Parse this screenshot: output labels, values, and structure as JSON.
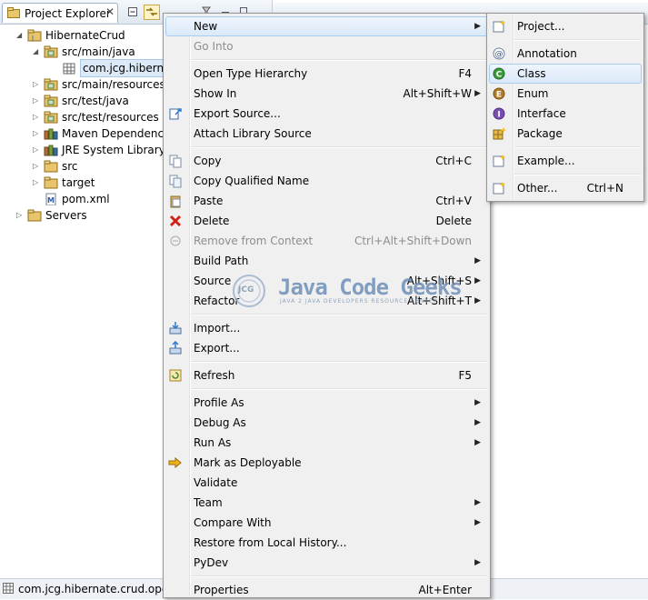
{
  "explorer": {
    "tab_title": "Project Explorer",
    "close_glyph": "✕",
    "tree": [
      {
        "label": "HibernateCrud",
        "level": 0,
        "expanded": true,
        "icon": "project-icon"
      },
      {
        "label": "src/main/java",
        "level": 1,
        "expanded": true,
        "icon": "source-folder-icon"
      },
      {
        "label": "com.jcg.hibernat",
        "level": 2,
        "selected": true,
        "icon": "package-icon"
      },
      {
        "label": "src/main/resources",
        "level": 1,
        "expanded": false,
        "icon": "source-folder-icon"
      },
      {
        "label": "src/test/java",
        "level": 1,
        "expanded": false,
        "icon": "source-folder-icon"
      },
      {
        "label": "src/test/resources",
        "level": 1,
        "expanded": false,
        "icon": "source-folder-icon"
      },
      {
        "label": "Maven Dependencie",
        "level": 1,
        "expanded": false,
        "icon": "library-icon"
      },
      {
        "label": "JRE System Library [j",
        "level": 1,
        "expanded": false,
        "icon": "library-icon"
      },
      {
        "label": "src",
        "level": 1,
        "expanded": false,
        "icon": "folder-icon"
      },
      {
        "label": "target",
        "level": 1,
        "expanded": false,
        "icon": "folder-icon"
      },
      {
        "label": "pom.xml",
        "level": 1,
        "icon": "maven-file-icon"
      },
      {
        "label": "Servers",
        "level": 0,
        "expanded": false,
        "icon": "folder-icon"
      }
    ]
  },
  "status_bar": {
    "text": "com.jcg.hibernate.crud.operat"
  },
  "context_menu": {
    "items": [
      {
        "type": "item",
        "label": "New",
        "submenu": true,
        "highlighted": true
      },
      {
        "type": "item",
        "label": "Go Into",
        "disabled": true
      },
      {
        "type": "sep"
      },
      {
        "type": "item",
        "label": "Open Type Hierarchy",
        "shortcut": "F4"
      },
      {
        "type": "item",
        "label": "Show In",
        "shortcut": "Alt+Shift+W",
        "submenu": true
      },
      {
        "type": "item",
        "label": "Export Source...",
        "icon": "export-source-icon"
      },
      {
        "type": "item",
        "label": "Attach Library Source"
      },
      {
        "type": "sep"
      },
      {
        "type": "item",
        "label": "Copy",
        "shortcut": "Ctrl+C",
        "icon": "copy-icon"
      },
      {
        "type": "item",
        "label": "Copy Qualified Name",
        "icon": "copy-qualified-icon"
      },
      {
        "type": "item",
        "label": "Paste",
        "shortcut": "Ctrl+V",
        "icon": "paste-icon"
      },
      {
        "type": "item",
        "label": "Delete",
        "shortcut": "Delete",
        "icon": "delete-icon"
      },
      {
        "type": "item",
        "label": "Remove from Context",
        "shortcut": "Ctrl+Alt+Shift+Down",
        "disabled": true,
        "icon": "remove-context-icon"
      },
      {
        "type": "item",
        "label": "Build Path",
        "submenu": true
      },
      {
        "type": "item",
        "label": "Source",
        "shortcut": "Alt+Shift+S",
        "submenu": true
      },
      {
        "type": "item",
        "label": "Refactor",
        "shortcut": "Alt+Shift+T",
        "submenu": true
      },
      {
        "type": "sep"
      },
      {
        "type": "item",
        "label": "Import...",
        "icon": "import-icon"
      },
      {
        "type": "item",
        "label": "Export...",
        "icon": "export-icon"
      },
      {
        "type": "sep"
      },
      {
        "type": "item",
        "label": "Refresh",
        "shortcut": "F5",
        "icon": "refresh-icon"
      },
      {
        "type": "sep"
      },
      {
        "type": "item",
        "label": "Profile As",
        "submenu": true
      },
      {
        "type": "item",
        "label": "Debug As",
        "submenu": true
      },
      {
        "type": "item",
        "label": "Run As",
        "submenu": true
      },
      {
        "type": "item",
        "label": "Mark as Deployable",
        "icon": "deployable-icon"
      },
      {
        "type": "item",
        "label": "Validate"
      },
      {
        "type": "item",
        "label": "Team",
        "submenu": true
      },
      {
        "type": "item",
        "label": "Compare With",
        "submenu": true
      },
      {
        "type": "item",
        "label": "Restore from Local History..."
      },
      {
        "type": "item",
        "label": "PyDev",
        "submenu": true
      },
      {
        "type": "sep"
      },
      {
        "type": "item",
        "label": "Properties",
        "shortcut": "Alt+Enter"
      }
    ]
  },
  "new_submenu": {
    "items": [
      {
        "type": "item",
        "label": "Project...",
        "icon": "new-project-icon"
      },
      {
        "type": "sep"
      },
      {
        "type": "item",
        "label": "Annotation",
        "icon": "annotation-icon"
      },
      {
        "type": "item",
        "label": "Class",
        "icon": "class-icon",
        "highlighted": true
      },
      {
        "type": "item",
        "label": "Enum",
        "icon": "enum-icon"
      },
      {
        "type": "item",
        "label": "Interface",
        "icon": "interface-icon"
      },
      {
        "type": "item",
        "label": "Package",
        "icon": "package-new-icon"
      },
      {
        "type": "sep"
      },
      {
        "type": "item",
        "label": "Example...",
        "icon": "example-icon"
      },
      {
        "type": "sep"
      },
      {
        "type": "item",
        "label": "Other...",
        "shortcut": "Ctrl+N",
        "icon": "other-icon"
      }
    ]
  },
  "watermark": {
    "logo_text": "JCG",
    "brand": "Java Code Geeks",
    "tagline": "JAVA 2 JAVA DEVELOPERS RESOURCE CENTER"
  },
  "submenu_arrow": "▶"
}
